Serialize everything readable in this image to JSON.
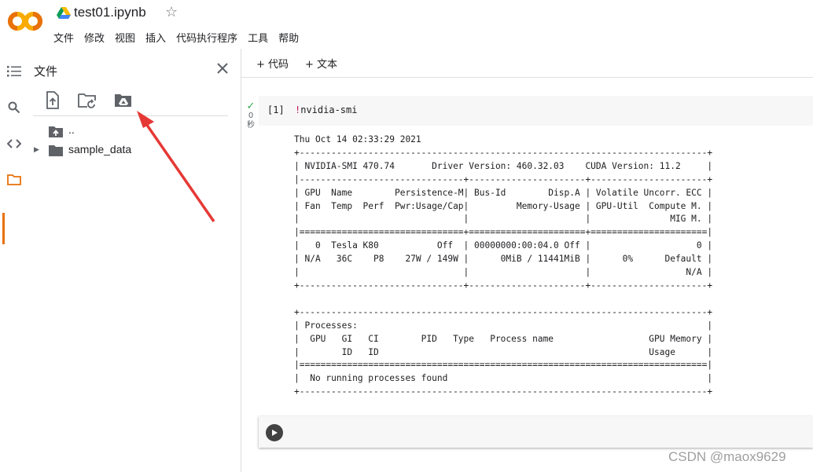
{
  "header": {
    "notebook_title": "test01.ipynb",
    "menu": [
      "文件",
      "修改",
      "视图",
      "插入",
      "代码执行程序",
      "工具",
      "帮助"
    ]
  },
  "rail_icons": [
    "toc-icon",
    "search-icon",
    "code-snippets-icon",
    "folder-icon"
  ],
  "files_panel": {
    "title": "文件",
    "tools": [
      "upload-icon",
      "refresh-folder-icon",
      "mount-drive-icon"
    ],
    "tree": [
      {
        "name": "..",
        "icon": "folder-up-icon"
      },
      {
        "name": "sample_data",
        "icon": "folder-icon"
      }
    ]
  },
  "toolbar": {
    "add_code": "+ 代码",
    "add_text": "+ 文本"
  },
  "cell": {
    "status_seconds": "0",
    "status_unit": "秒",
    "exec_count": "[1]",
    "code_bang": "!",
    "code_rest": "nvidia-smi",
    "output": "Thu Oct 14 02:33:29 2021\n+-----------------------------------------------------------------------------+\n| NVIDIA-SMI 470.74       Driver Version: 460.32.03    CUDA Version: 11.2     |\n|-------------------------------+----------------------+----------------------+\n| GPU  Name        Persistence-M| Bus-Id        Disp.A | Volatile Uncorr. ECC |\n| Fan  Temp  Perf  Pwr:Usage/Cap|         Memory-Usage | GPU-Util  Compute M. |\n|                               |                      |               MIG M. |\n|===============================+======================+======================|\n|   0  Tesla K80           Off  | 00000000:00:04.0 Off |                    0 |\n| N/A   36C    P8    27W / 149W |      0MiB / 11441MiB |      0%      Default |\n|                               |                      |                  N/A |\n+-------------------------------+----------------------+----------------------+\n\n+-----------------------------------------------------------------------------+\n| Processes:                                                                  |\n|  GPU   GI   CI        PID   Type   Process name                  GPU Memory |\n|        ID   ID                                                   Usage      |\n|=============================================================================|\n|  No running processes found                                                 |\n+-----------------------------------------------------------------------------+"
  },
  "watermark": "CSDN @maox9629"
}
